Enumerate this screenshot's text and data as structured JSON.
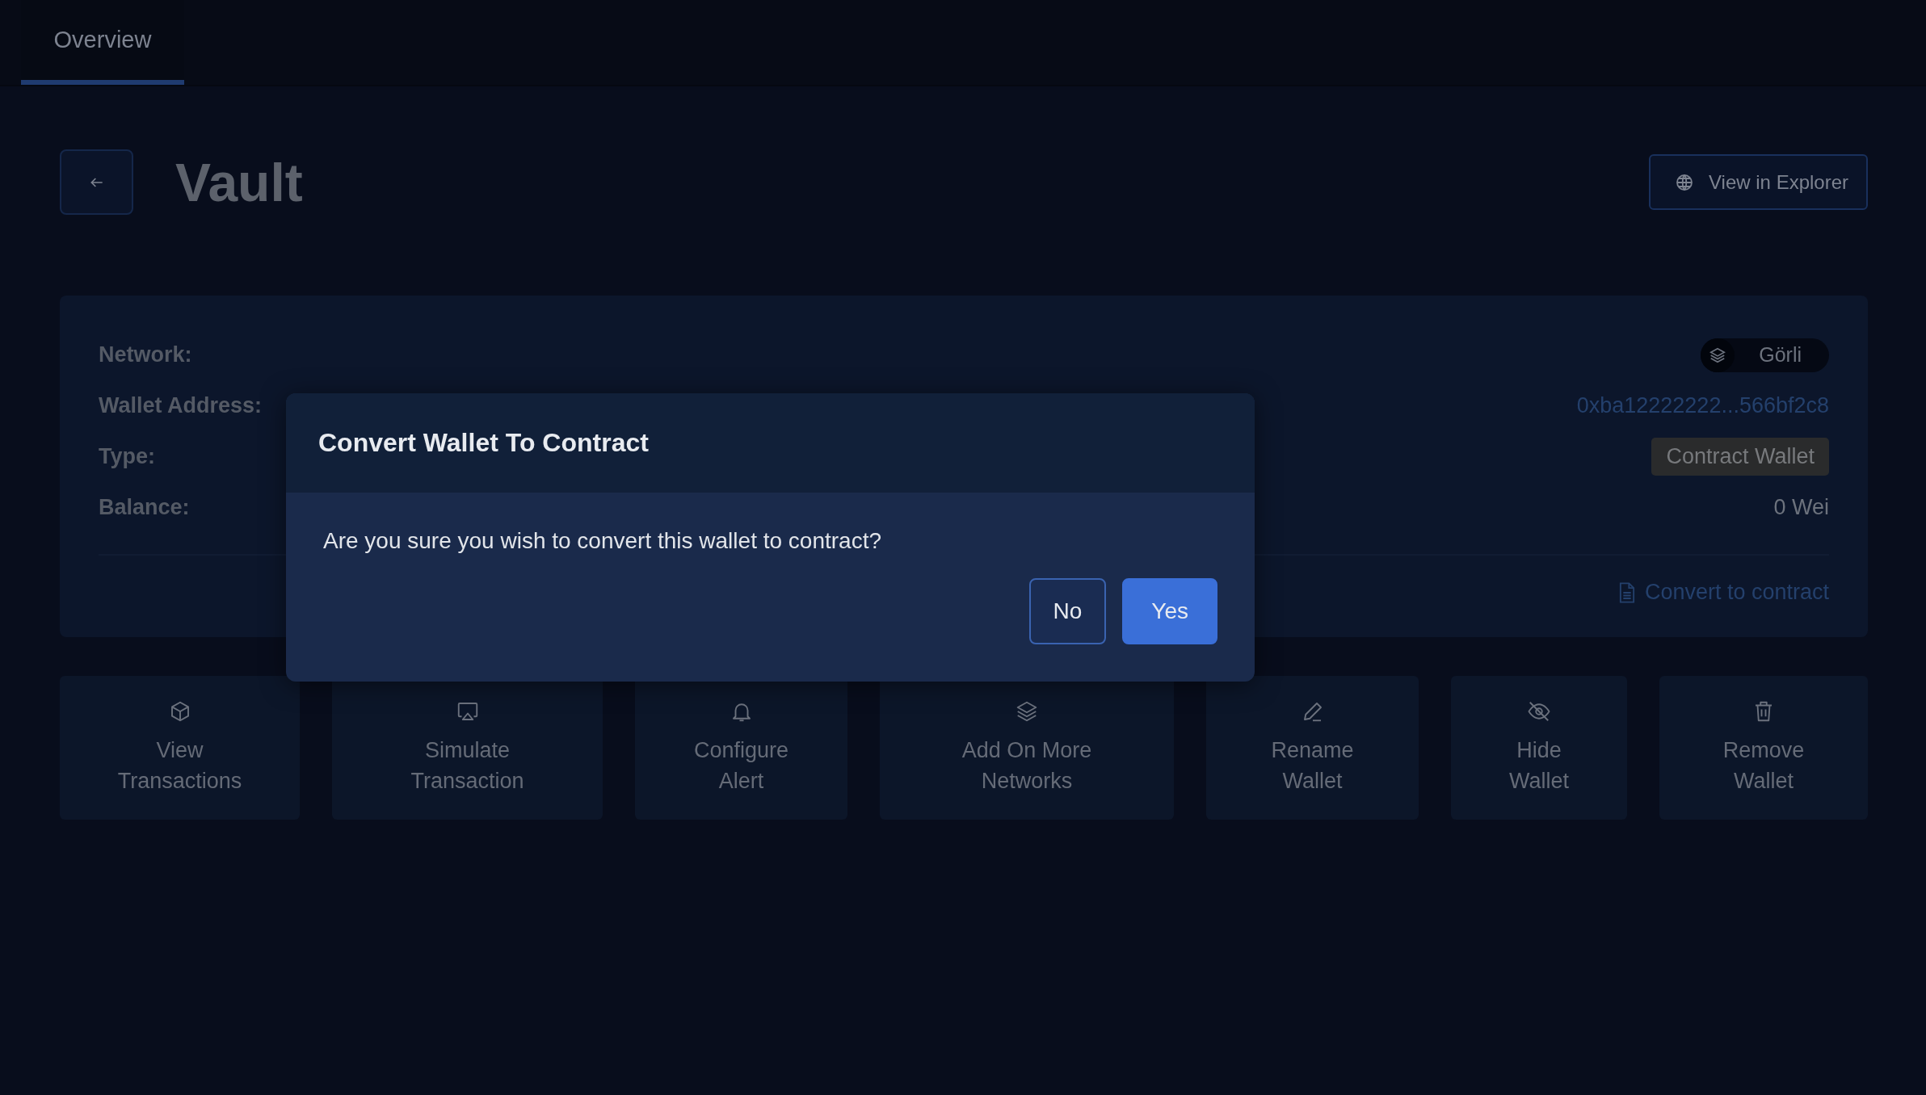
{
  "tabs": [
    {
      "label": "Overview",
      "selected": true
    }
  ],
  "header": {
    "title": "Vault",
    "explorer_button": "View in Explorer"
  },
  "details": [
    {
      "kind": "network",
      "label": "Network:",
      "value": "Görli"
    },
    {
      "kind": "address",
      "label": "Wallet Address:",
      "value": "0xba12222222...566bf2c8"
    },
    {
      "kind": "badge",
      "label": "Type:",
      "value": "Contract Wallet"
    },
    {
      "kind": "plain",
      "label": "Balance:",
      "value": "0 Wei"
    }
  ],
  "convert_link": "Convert to contract",
  "actions": [
    {
      "label": "View\nTransactions"
    },
    {
      "label": "Simulate\nTransaction"
    },
    {
      "label": "Configure\nAlert"
    },
    {
      "label": "Add On More\nNetworks"
    },
    {
      "label": "Rename\nWallet"
    },
    {
      "label": "Hide\nWallet"
    },
    {
      "label": "Remove\nWallet"
    }
  ],
  "dialog": {
    "title": "Convert Wallet To Contract",
    "message": "Are you sure you wish to convert this wallet to contract?",
    "buttons": [
      {
        "label": "No",
        "kind": "secondary"
      },
      {
        "label": "Yes",
        "kind": "primary"
      }
    ]
  }
}
